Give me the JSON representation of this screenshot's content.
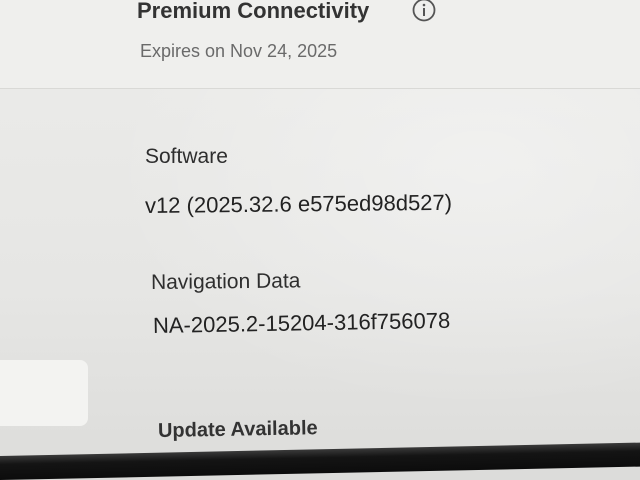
{
  "premium": {
    "title": "Premium Connectivity",
    "expires": "Expires on Nov 24, 2025",
    "info_icon": "info-circle-icon"
  },
  "software": {
    "label": "Software",
    "version": "v12 (2025.32.6 e575ed98d527)"
  },
  "navigation": {
    "label": "Navigation Data",
    "version": "NA-2025.2-15204-316f756078"
  },
  "update": {
    "label": "Update Available"
  },
  "colors": {
    "background": "#e9e9e7",
    "text": "#2a2a2a",
    "secondary_text": "#6a6a6a",
    "bezel": "#0c0c0c"
  }
}
